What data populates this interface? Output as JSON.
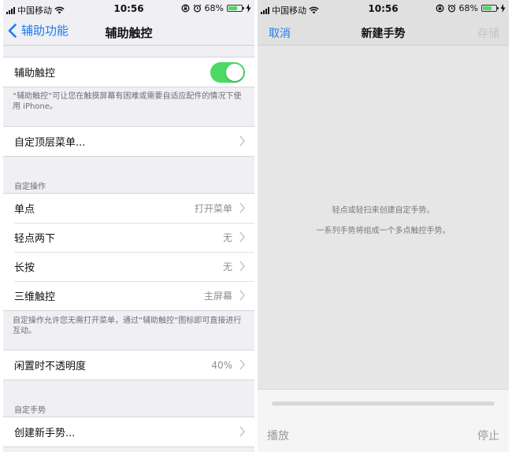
{
  "status": {
    "carrier": "中国移动",
    "time": "10:56",
    "battery": "68%",
    "battery_level": 0.68
  },
  "left": {
    "nav": {
      "back": "辅助功能",
      "title": "辅助触控"
    },
    "toggle_row": {
      "label": "辅助触控",
      "on": true
    },
    "toggle_footer": "“辅助触控”可让您在触摸屏幕有困难或需要自适应配件的情况下使用 iPhone。",
    "menu_row": {
      "label": "自定顶层菜单..."
    },
    "custom_actions": {
      "header": "自定操作",
      "items": [
        {
          "label": "单点",
          "value": "打开菜单"
        },
        {
          "label": "轻点两下",
          "value": "无"
        },
        {
          "label": "长按",
          "value": "无"
        },
        {
          "label": "三维触控",
          "value": "主屏幕"
        }
      ],
      "footer": "自定操作允许您无需打开菜单，通过“辅助触控”图标即可直接进行互动。"
    },
    "opacity_row": {
      "label": "闲置时不透明度",
      "value": "40%"
    },
    "custom_gestures": {
      "header": "自定手势",
      "create": "创建新手势..."
    }
  },
  "right": {
    "nav": {
      "cancel": "取消",
      "title": "新建手势",
      "save": "存储"
    },
    "hint1": "轻点或轻扫来创建自定手势。",
    "hint2": "一系列手势将组成一个多点触控手势。",
    "play": "播放",
    "stop": "停止"
  },
  "colors": {
    "accent": "#1a7cf5",
    "toggle_on": "#4cd964",
    "list_background": "#efeff4"
  },
  "icons": [
    "wifi-icon",
    "signal-icon",
    "lock-rotation-icon",
    "alarm-icon",
    "battery-icon",
    "charging-icon",
    "back-chevron-icon",
    "chevron-right-icon"
  ]
}
